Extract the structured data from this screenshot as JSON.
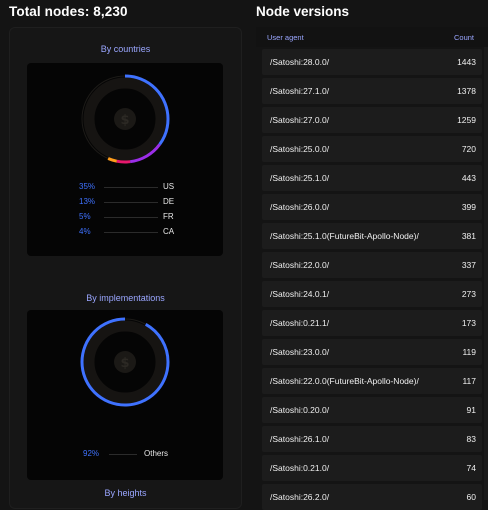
{
  "total_title": "Total nodes: 8,230",
  "versions_title": "Node versions",
  "countries": {
    "title": "By countries",
    "legend": [
      {
        "pct": "35%",
        "label": "US"
      },
      {
        "pct": "13%",
        "label": "DE"
      },
      {
        "pct": "5%",
        "label": "FR"
      },
      {
        "pct": "4%",
        "label": "CA"
      }
    ]
  },
  "implementations": {
    "title": "By implementations",
    "legend": [
      {
        "pct": "92%",
        "label": "Others"
      }
    ]
  },
  "heights": {
    "title": "By heights"
  },
  "table": {
    "col_agent": "User agent",
    "col_count": "Count",
    "rows": [
      {
        "agent": "/Satoshi:28.0.0/",
        "count": "1443"
      },
      {
        "agent": "/Satoshi:27.1.0/",
        "count": "1378"
      },
      {
        "agent": "/Satoshi:27.0.0/",
        "count": "1259"
      },
      {
        "agent": "/Satoshi:25.0.0/",
        "count": "720"
      },
      {
        "agent": "/Satoshi:25.1.0/",
        "count": "443"
      },
      {
        "agent": "/Satoshi:26.0.0/",
        "count": "399"
      },
      {
        "agent": "/Satoshi:25.1.0(FutureBit-Apollo-Node)/",
        "count": "381"
      },
      {
        "agent": "/Satoshi:22.0.0/",
        "count": "337"
      },
      {
        "agent": "/Satoshi:24.0.1/",
        "count": "273"
      },
      {
        "agent": "/Satoshi:0.21.1/",
        "count": "173"
      },
      {
        "agent": "/Satoshi:23.0.0/",
        "count": "119"
      },
      {
        "agent": "/Satoshi:22.0.0(FutureBit-Apollo-Node)/",
        "count": "117"
      },
      {
        "agent": "/Satoshi:0.20.0/",
        "count": "91"
      },
      {
        "agent": "/Satoshi:26.1.0/",
        "count": "83"
      },
      {
        "agent": "/Satoshi:0.21.0/",
        "count": "74"
      },
      {
        "agent": "/Satoshi:26.2.0/",
        "count": "60"
      }
    ]
  },
  "colors": {
    "accent_blue": "#3f72ff",
    "purple": "#9b2ee8",
    "magenta": "#e8186d",
    "orange": "#ff9d1c"
  }
}
